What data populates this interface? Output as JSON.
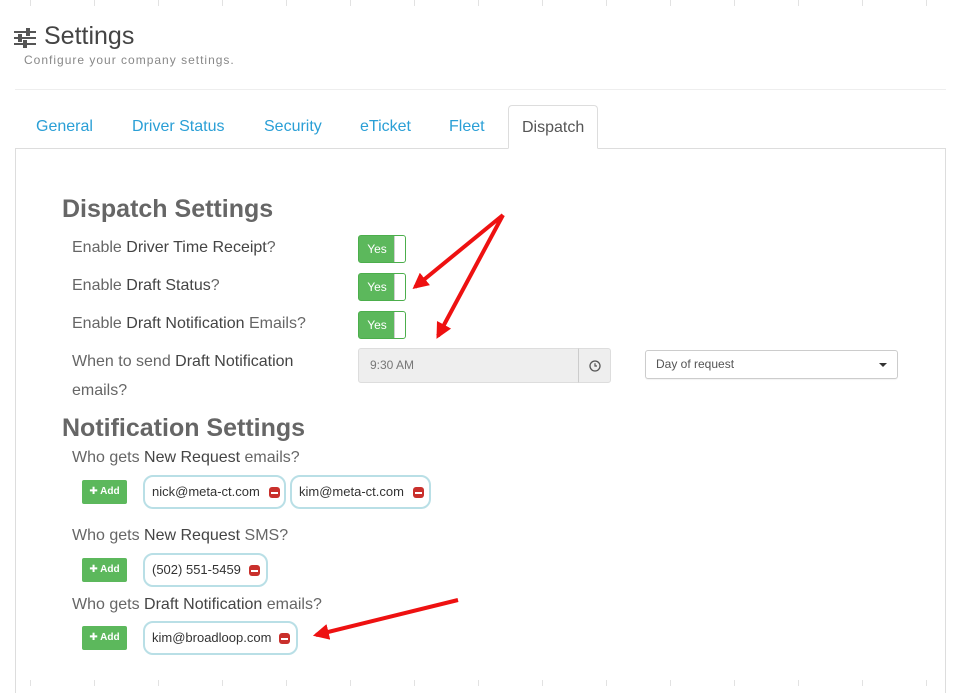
{
  "page": {
    "title": "Settings",
    "subtitle": "Configure your company settings.",
    "icon": "sliders-icon"
  },
  "tabs": [
    {
      "label": "General",
      "active": false
    },
    {
      "label": "Driver Status",
      "active": false
    },
    {
      "label": "Security",
      "active": false
    },
    {
      "label": "eTicket",
      "active": false
    },
    {
      "label": "Fleet",
      "active": false
    },
    {
      "label": "Dispatch",
      "active": true
    }
  ],
  "dispatch": {
    "title": "Dispatch Settings",
    "driver_time_receipt": {
      "pre": "Enable ",
      "hl": "Driver Time Receipt",
      "post": "?",
      "toggle": "Yes"
    },
    "draft_status": {
      "pre": "Enable ",
      "hl": "Draft Status",
      "post": "?",
      "toggle": "Yes"
    },
    "draft_notification": {
      "pre": "Enable ",
      "hl": "Draft Notification",
      "post": " Emails?",
      "toggle": "Yes"
    },
    "send_when": {
      "line1_pre": "When to send ",
      "line1_hl": "Draft Notification",
      "line2": "emails?",
      "time": "9:30 AM",
      "time_icon": "clock-icon",
      "day_option": "Day of request"
    }
  },
  "notification": {
    "title": "Notification Settings",
    "new_request_emails": {
      "pre": "Who gets ",
      "hl": "New Request",
      "post": " emails?",
      "add": "Add",
      "recipients": [
        "nick@meta-ct.com",
        "kim@meta-ct.com"
      ]
    },
    "new_request_sms": {
      "pre": "Who gets ",
      "hl": "New Request",
      "post": " SMS?",
      "add": "Add",
      "recipients": [
        "(502) 551-5459"
      ]
    },
    "draft_emails": {
      "pre": "Who gets ",
      "hl": "Draft Notification",
      "post": " emails?",
      "add": "Add",
      "recipients": [
        "kim@broadloop.com"
      ]
    }
  },
  "colors": {
    "accent_link": "#2a9fd6",
    "toggle_on": "#5cb85c",
    "remove": "#c9302c",
    "annotation_arrow": "#ee1111"
  }
}
